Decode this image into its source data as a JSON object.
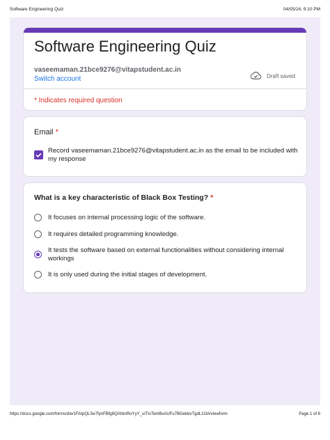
{
  "print_header": {
    "title": "Software Engineering Quiz",
    "datetime": "04/05/24, 9:10 PM"
  },
  "print_footer": {
    "url": "https://docs.google.com/forms/d/e/1FAIpQLSe7fynFBfg8QANmRoYyY_uiTtsTemBvAUFu7BGekbvTgdL1OA/viewform",
    "page": "Page 1 of 8"
  },
  "colors": {
    "accent": "#673ab7",
    "background": "#f0ebf8",
    "required": "#d93025",
    "link": "#1a73e8"
  },
  "form": {
    "title": "Software Engineering Quiz",
    "account_email": "vaseemaman.21bce9276@vitapstudent.ac.in",
    "switch_account": "Switch account",
    "draft_status": "Draft saved",
    "draft_icon": "cloud-done-icon",
    "required_note": "* Indicates required question"
  },
  "email_question": {
    "label": "Email",
    "required_marker": "*",
    "checkbox_checked": true,
    "checkbox_text": "Record vaseemaman.21bce9276@vitapstudent.ac.in as the email to be included with my response"
  },
  "question": {
    "label": "What is a key characteristic of Black Box Testing?",
    "required_marker": "*",
    "options": [
      {
        "text": "It focuses on internal processing logic of the software.",
        "selected": false
      },
      {
        "text": "It requires detailed programming knowledge.",
        "selected": false
      },
      {
        "text": "It tests the software based on external functionalities without considering internal workings",
        "selected": true
      },
      {
        "text": "It is only used during the initial stages of development.",
        "selected": false
      }
    ]
  }
}
